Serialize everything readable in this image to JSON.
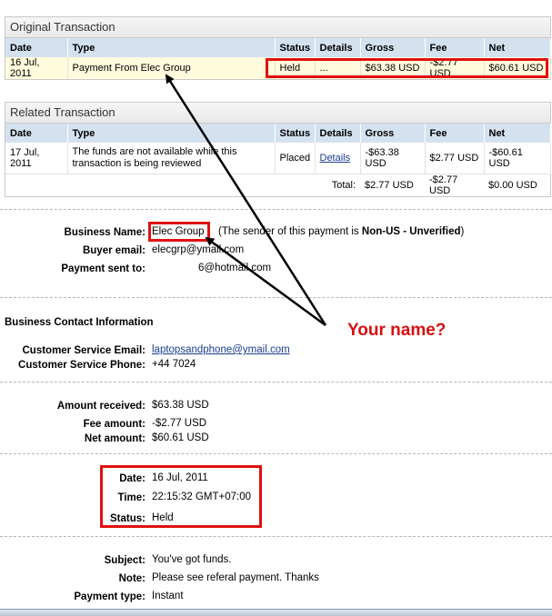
{
  "original": {
    "title": "Original Transaction",
    "columns": [
      "Date",
      "Type",
      "Status",
      "Details",
      "Gross",
      "Fee",
      "Net"
    ],
    "row": {
      "date": "16 Jul, 2011",
      "type": "Payment From Elec Group",
      "status": "Held",
      "details": "...",
      "gross": "$63.38 USD",
      "fee": "-$2.77 USD",
      "net": "$60.61 USD"
    }
  },
  "related": {
    "title": "Related Transaction",
    "columns": [
      "Date",
      "Type",
      "Status",
      "Details",
      "Gross",
      "Fee",
      "Net"
    ],
    "row": {
      "date": "17 Jul, 2011",
      "type": "The funds are not available while this transaction is being reviewed",
      "status": "Placed",
      "details": "Details",
      "gross": "-$63.38 USD",
      "fee": "$2.77 USD",
      "net": "-$60.61 USD"
    },
    "total": {
      "label": "Total:",
      "gross": "$2.77 USD",
      "fee": "-$2.77 USD",
      "net": "$0.00 USD"
    }
  },
  "business": {
    "name_label": "Business Name:",
    "name": "Elec Group",
    "sender_note_prefix": "(The sender of this payment is ",
    "sender_note_bold": "Non-US - Unverified",
    "sender_note_suffix": ")",
    "buyer_email_label": "Buyer email:",
    "buyer_email": "elecgrp@ymail.com",
    "sent_to_label": "Payment sent to:",
    "sent_to": "6@hotmail.com"
  },
  "contact": {
    "heading": "Business Contact Information",
    "cs_email_label": "Customer Service Email:",
    "cs_email": "laptopsandphone@ymail.com",
    "cs_phone_label": "Customer Service Phone:",
    "cs_phone": "+44 7024"
  },
  "amounts": {
    "received_label": "Amount received:",
    "received": "$63.38 USD",
    "fee_label": "Fee amount:",
    "fee": "-$2.77 USD",
    "net_label": "Net amount:",
    "net": "$60.61 USD"
  },
  "status_block": {
    "date_label": "Date:",
    "date": "16 Jul, 2011",
    "time_label": "Time:",
    "time": "22:15:32 GMT+07:00",
    "status_label": "Status:",
    "status": "Held"
  },
  "message": {
    "subject_label": "Subject:",
    "subject": "You've got funds.",
    "note_label": "Note:",
    "note": "Please see referal payment. Thanks",
    "type_label": "Payment type:",
    "type": "Instant"
  },
  "annotation": {
    "text": "Your name?",
    "color": "#d91010"
  }
}
